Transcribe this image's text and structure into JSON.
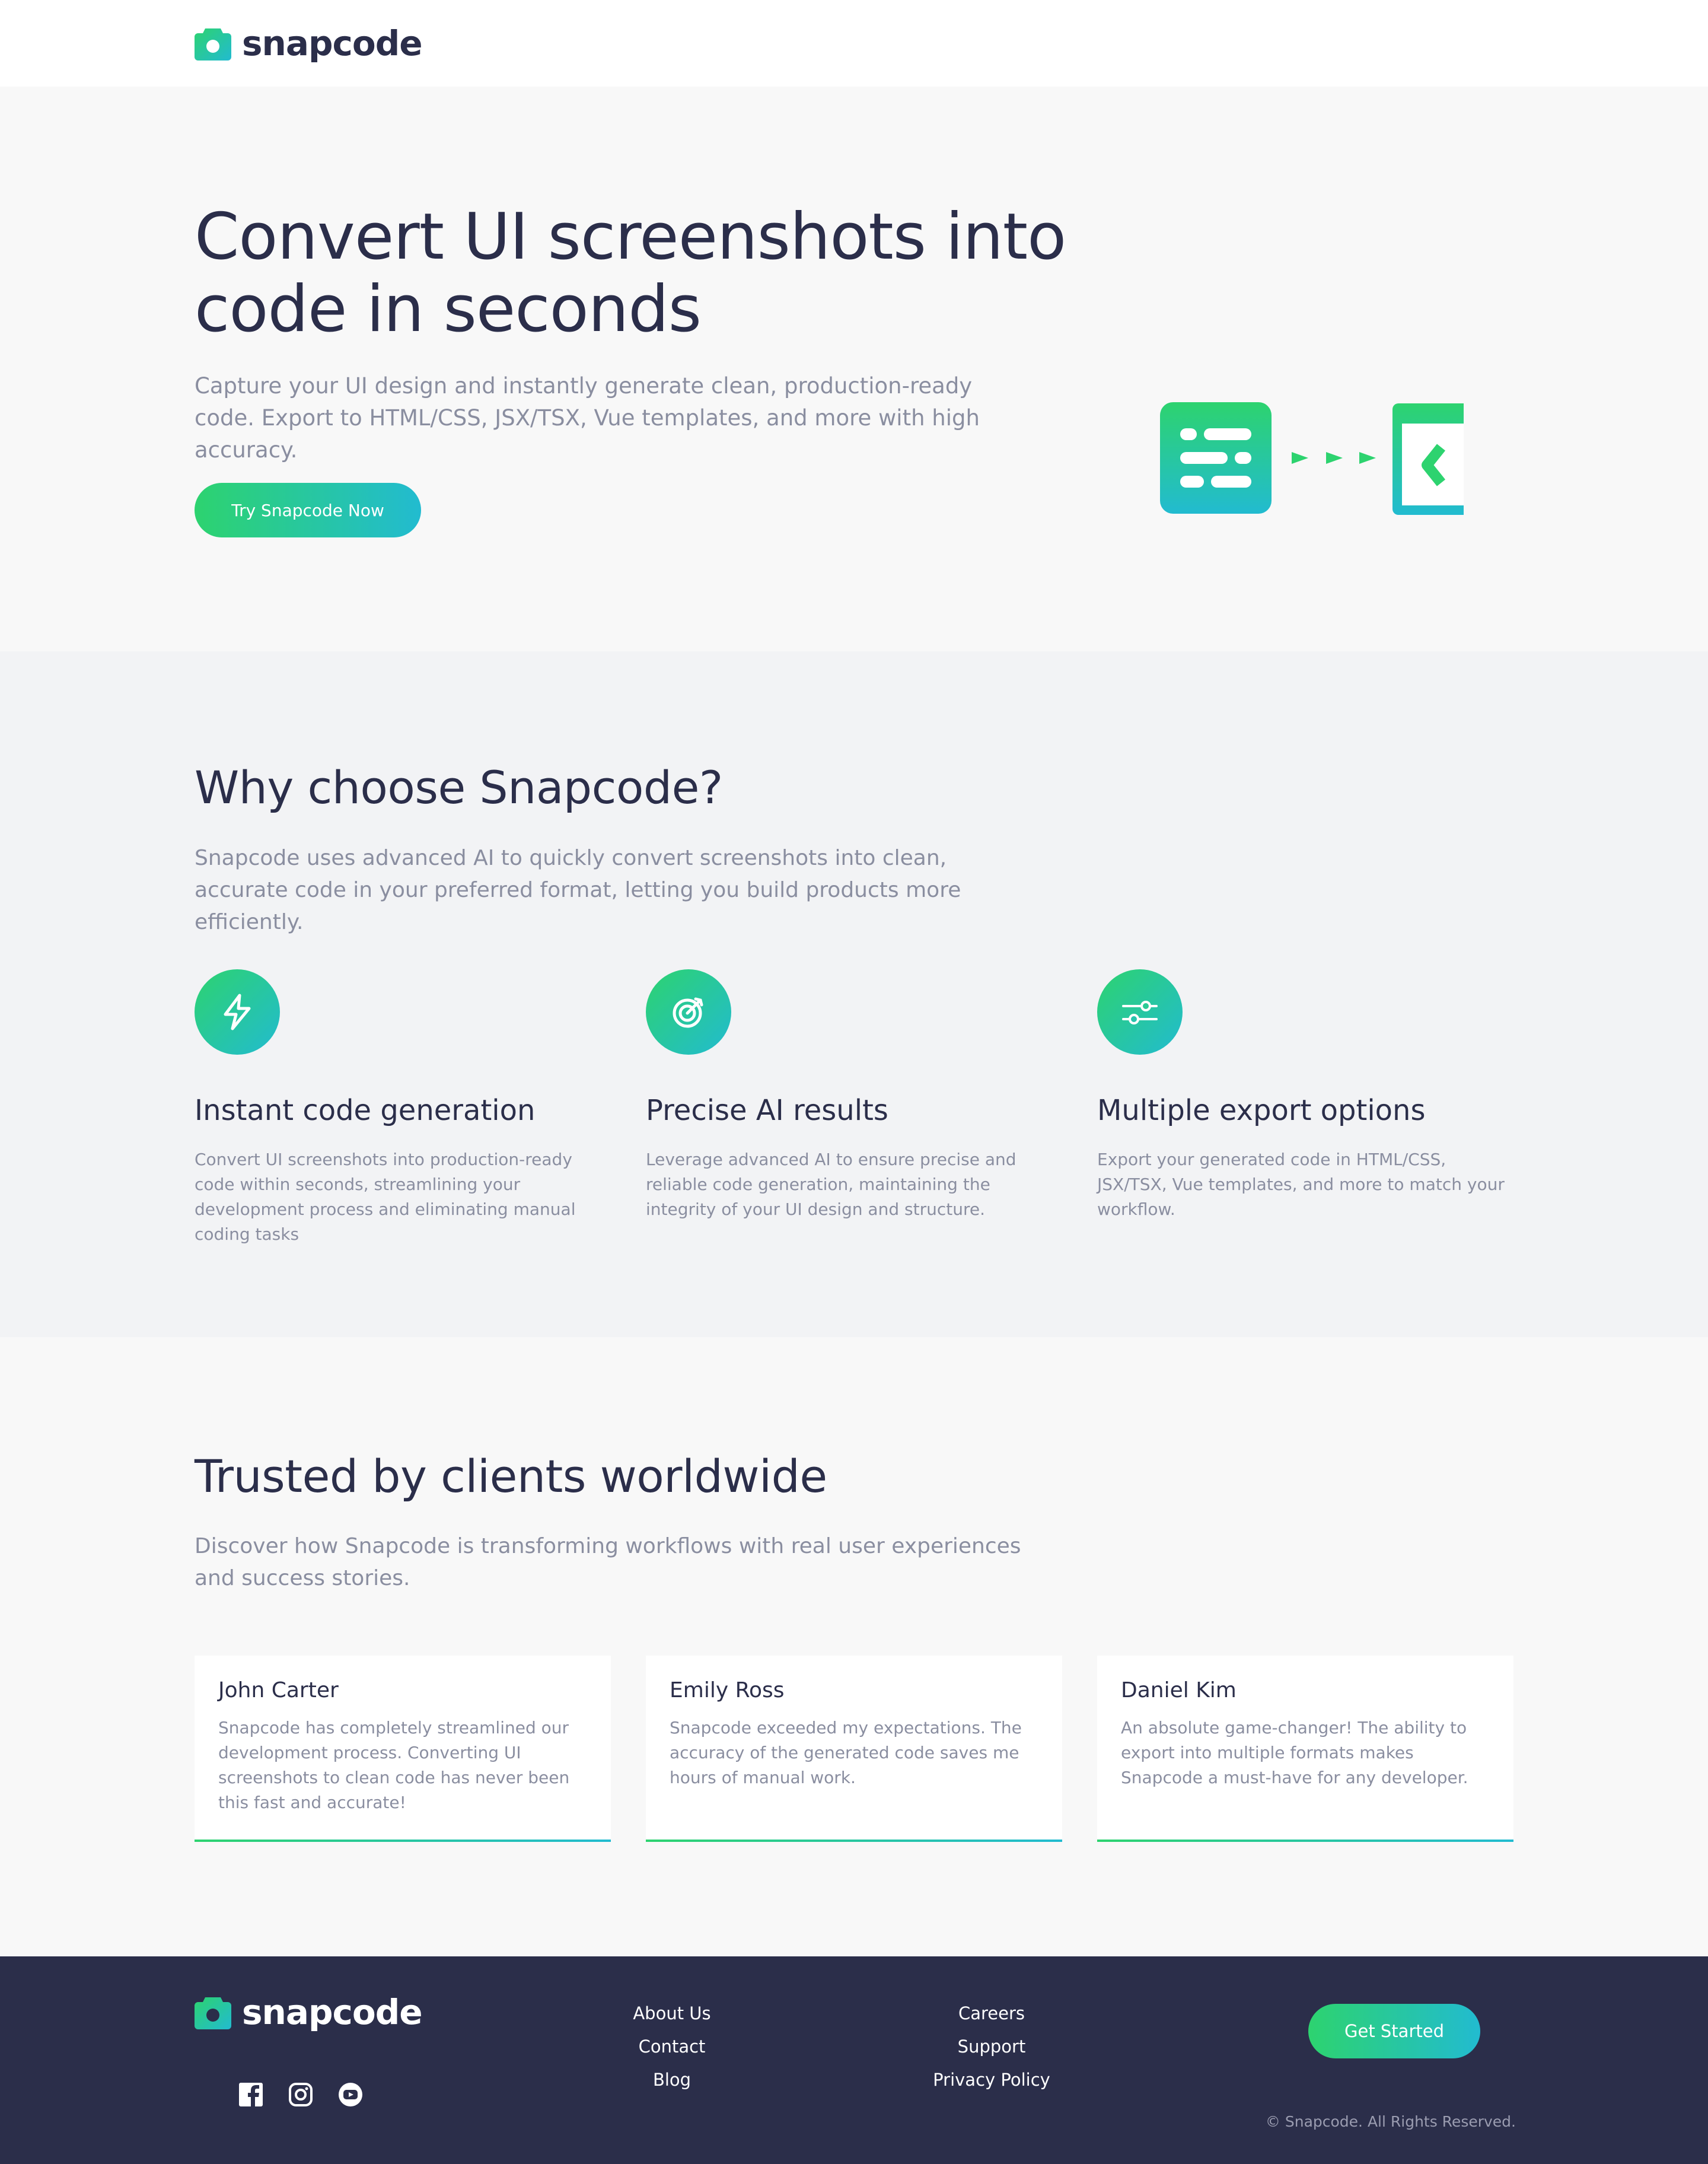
{
  "brand": {
    "name": "snapcode",
    "accent_start": "#2dd36f",
    "accent_end": "#22bbd0",
    "dark": "#2b2e4a"
  },
  "hero": {
    "title": "Convert UI screenshots into code in seconds",
    "description": "Capture your UI design and instantly generate clean, production-ready code. Export to HTML/CSS, JSX/TSX, Vue templates, and more with high accuracy.",
    "cta_label": "Try Snapcode Now",
    "illustration_icons": [
      "screenshot-layout-icon",
      "arrows-icon",
      "code-window-icon"
    ]
  },
  "features": {
    "title": "Why choose Snapcode?",
    "description": "Snapcode uses advanced AI to quickly convert screenshots into clean, accurate code in your preferred format, letting you build products more efficiently.",
    "items": [
      {
        "icon": "lightning-icon",
        "title": "Instant code generation",
        "text": "Convert UI screenshots into production-ready code within seconds, streamlining your development process and eliminating manual coding tasks"
      },
      {
        "icon": "target-icon",
        "title": "Precise AI results",
        "text": "Leverage advanced AI to ensure precise and reliable code generation, maintaining the integrity of your UI design and structure."
      },
      {
        "icon": "sliders-icon",
        "title": "Multiple export options",
        "text": "Export your generated code in HTML/CSS, JSX/TSX, Vue templates, and more to match your workflow."
      }
    ]
  },
  "testimonials": {
    "title": "Trusted by clients worldwide",
    "description": "Discover how Snapcode is transforming workflows with real user experiences and success stories.",
    "items": [
      {
        "name": "John Carter",
        "quote": "Snapcode has completely streamlined our development process. Converting UI screenshots to clean code has never been this fast and accurate!"
      },
      {
        "name": "Emily Ross",
        "quote": "Snapcode exceeded my expectations. The accuracy of the generated code saves me hours of manual work."
      },
      {
        "name": "Daniel Kim",
        "quote": "An absolute game-changer! The ability to export into multiple formats makes Snapcode a must-have for any developer."
      }
    ]
  },
  "footer": {
    "brand": "snapcode",
    "social_icons": [
      "facebook-icon",
      "instagram-icon",
      "youtube-icon"
    ],
    "links_col1": [
      "About Us",
      "Contact",
      "Blog"
    ],
    "links_col2": [
      "Careers",
      "Support",
      "Privacy Policy"
    ],
    "cta_label": "Get Started",
    "copyright": "© Snapcode. All Rights Reserved."
  }
}
